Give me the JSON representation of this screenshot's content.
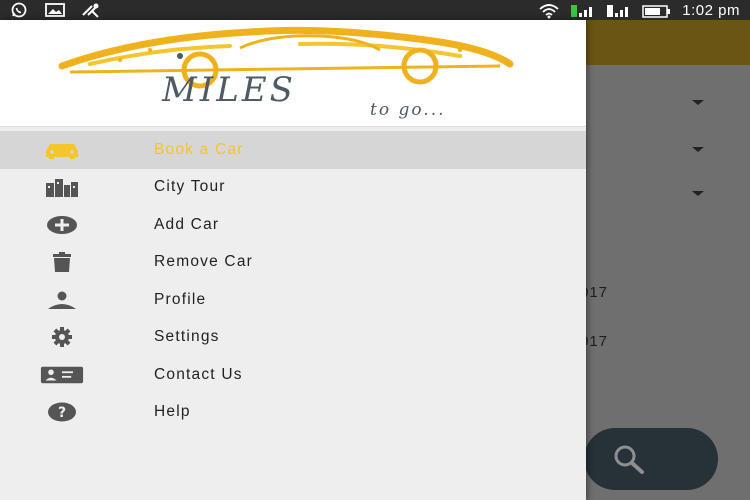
{
  "status_bar": {
    "time": "1:02 pm",
    "left_icons": [
      "whatsapp-icon",
      "gallery-icon",
      "tools-icon"
    ],
    "right_icons": [
      "wifi-icon",
      "signal-icon",
      "signal-icon",
      "battery-icon"
    ]
  },
  "app": {
    "logo_main": "MILES",
    "logo_sub": "to go..."
  },
  "drawer": {
    "items": [
      {
        "label": "Book a Car",
        "icon": "car-icon",
        "active": true
      },
      {
        "label": "City Tour",
        "icon": "city-icon",
        "active": false
      },
      {
        "label": "Add Car",
        "icon": "add-circle-icon",
        "active": false
      },
      {
        "label": "Remove Car",
        "icon": "trash-icon",
        "active": false
      },
      {
        "label": "Profile",
        "icon": "person-icon",
        "active": false
      },
      {
        "label": "Settings",
        "icon": "gear-icon",
        "active": false
      },
      {
        "label": "Contact Us",
        "icon": "contact-card-icon",
        "active": false
      },
      {
        "label": "Help",
        "icon": "help-icon",
        "active": false
      }
    ]
  },
  "background": {
    "date_1": "017",
    "date_2": "017",
    "fab_icon": "search-icon"
  },
  "colors": {
    "accent": "#f5c52c",
    "status_bar": "#2b2b2b",
    "drawer_bg": "#eeeeee",
    "active_item_bg": "#d6d6d6",
    "toolbar_dimmed": "#6b5514",
    "fab": "#263238"
  }
}
